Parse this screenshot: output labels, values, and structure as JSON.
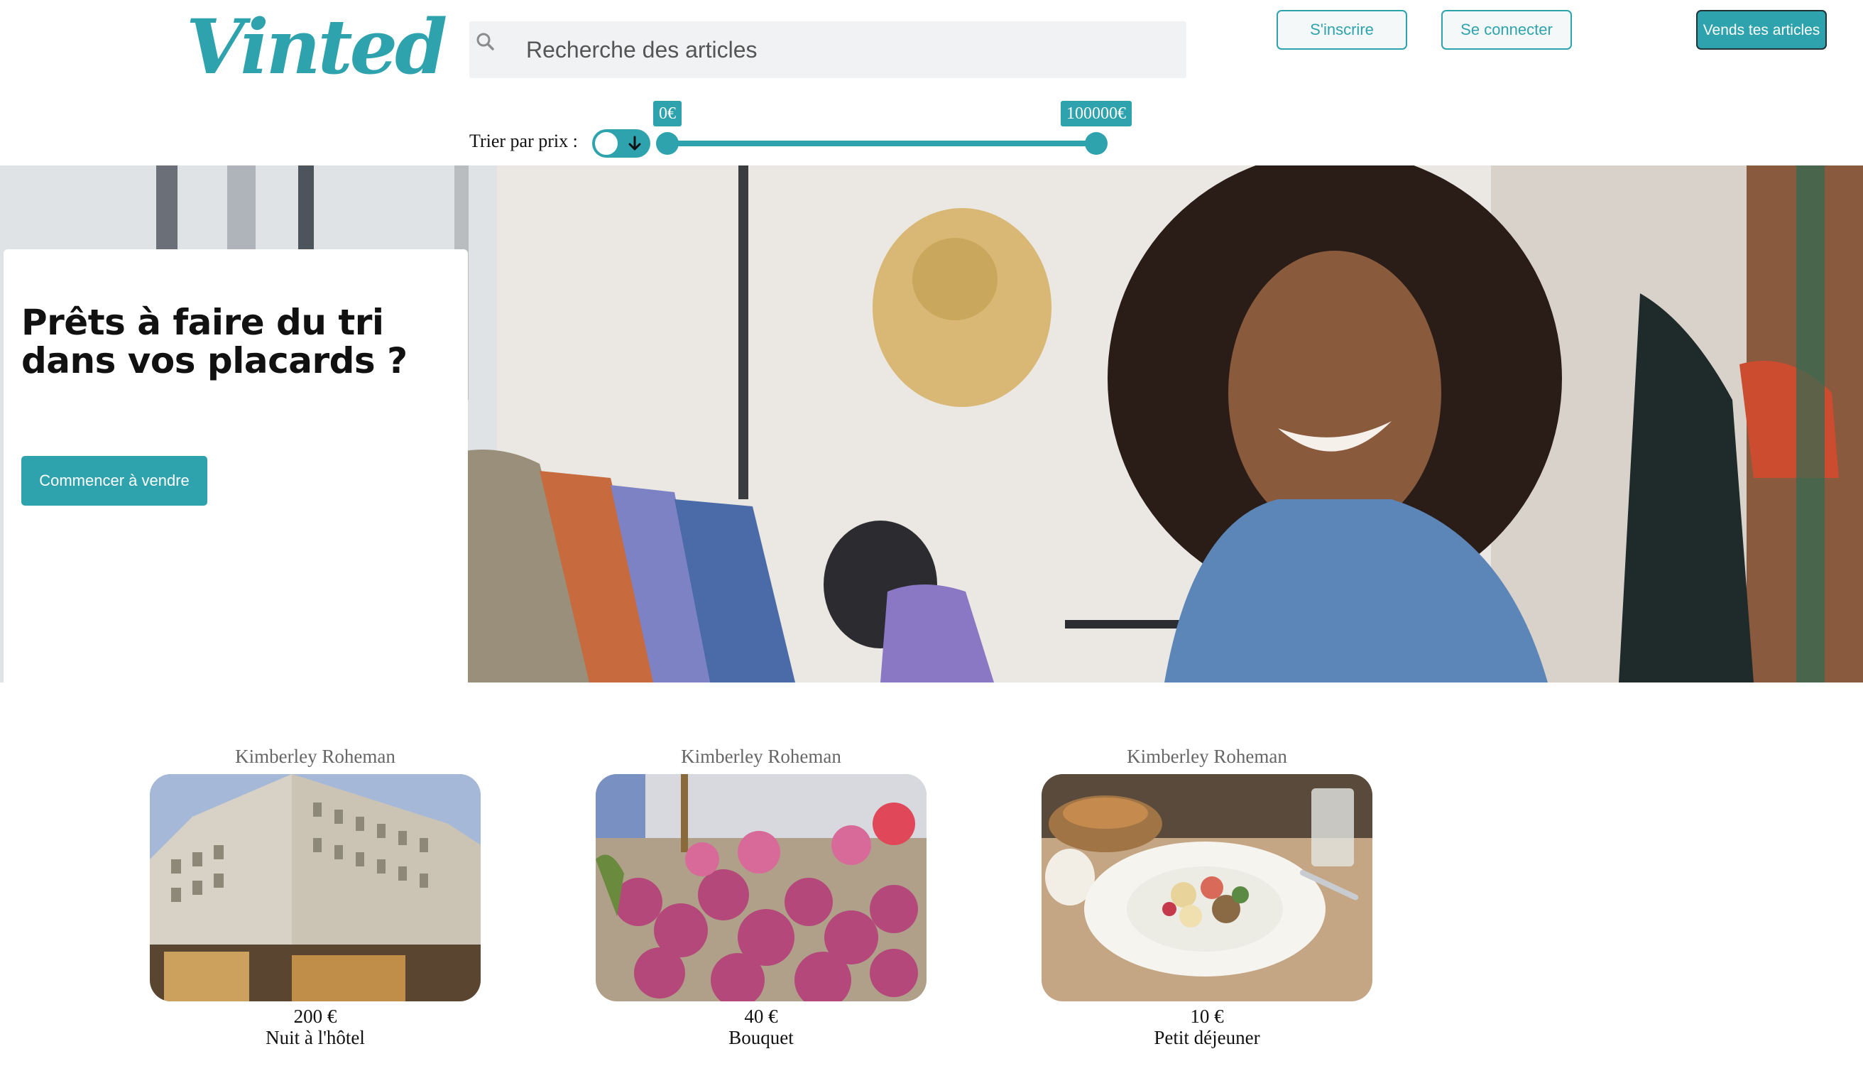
{
  "header": {
    "logo_text": "Vinted",
    "search_placeholder": "Recherche des articles",
    "signup_label": "S'inscrire",
    "login_label": "Se connecter",
    "sell_label": "Vends tes articles"
  },
  "filter": {
    "sort_label": "Trier par prix :",
    "sort_direction_icon": "arrow-down-icon",
    "price_min_label": "0€",
    "price_max_label": "100000€",
    "price_min_fraction": 0,
    "price_max_fraction": 1
  },
  "hero": {
    "title": "Prêts à faire du tri dans vos placards ?",
    "cta_label": "Commencer à vendre"
  },
  "products": [
    {
      "owner": "Kimberley Roheman",
      "price": "200 €",
      "title": "Nuit à l'hôtel"
    },
    {
      "owner": "Kimberley Roheman",
      "price": "40 €",
      "title": "Bouquet"
    },
    {
      "owner": "Kimberley Roheman",
      "price": "10 €",
      "title": "Petit déjeuner"
    }
  ],
  "colors": {
    "accent": "#2fa3ad",
    "search_bg": "#f1f2f3",
    "text": "#111111"
  }
}
